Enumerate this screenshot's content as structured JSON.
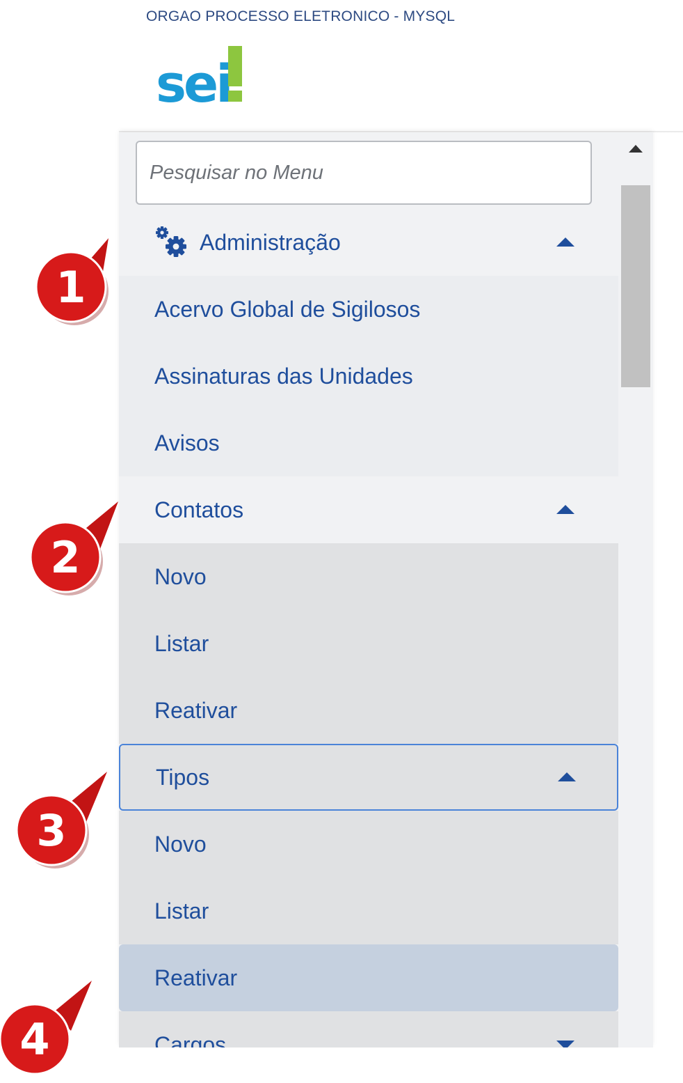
{
  "header": {
    "org_name": "ORGAO PROCESSO ELETRONICO - MYSQL",
    "logo": {
      "letters": "sei",
      "mark": "!",
      "colors": {
        "letters": "#1c9ad6",
        "mark": "#8dc63f"
      }
    }
  },
  "search": {
    "placeholder": "Pesquisar no Menu"
  },
  "menu": {
    "items": [
      {
        "label": "Administração",
        "icon": "gears-icon",
        "expanded": true
      },
      {
        "label": "Acervo Global de Sigilosos"
      },
      {
        "label": "Assinaturas das Unidades"
      },
      {
        "label": "Avisos"
      },
      {
        "label": "Contatos",
        "expanded": true
      },
      {
        "label": "Novo"
      },
      {
        "label": "Listar"
      },
      {
        "label": "Reativar"
      },
      {
        "label": "Tipos",
        "expanded": true,
        "focused": true
      },
      {
        "label": "Novo"
      },
      {
        "label": "Listar"
      },
      {
        "label": "Reativar",
        "selected": true
      },
      {
        "label": "Cargos",
        "expanded": false
      }
    ]
  },
  "callouts": [
    "1",
    "2",
    "3",
    "4"
  ],
  "colors": {
    "link": "#1f4e9c",
    "callout": "#d71a1a",
    "selected_bg": "#c5d0df"
  }
}
